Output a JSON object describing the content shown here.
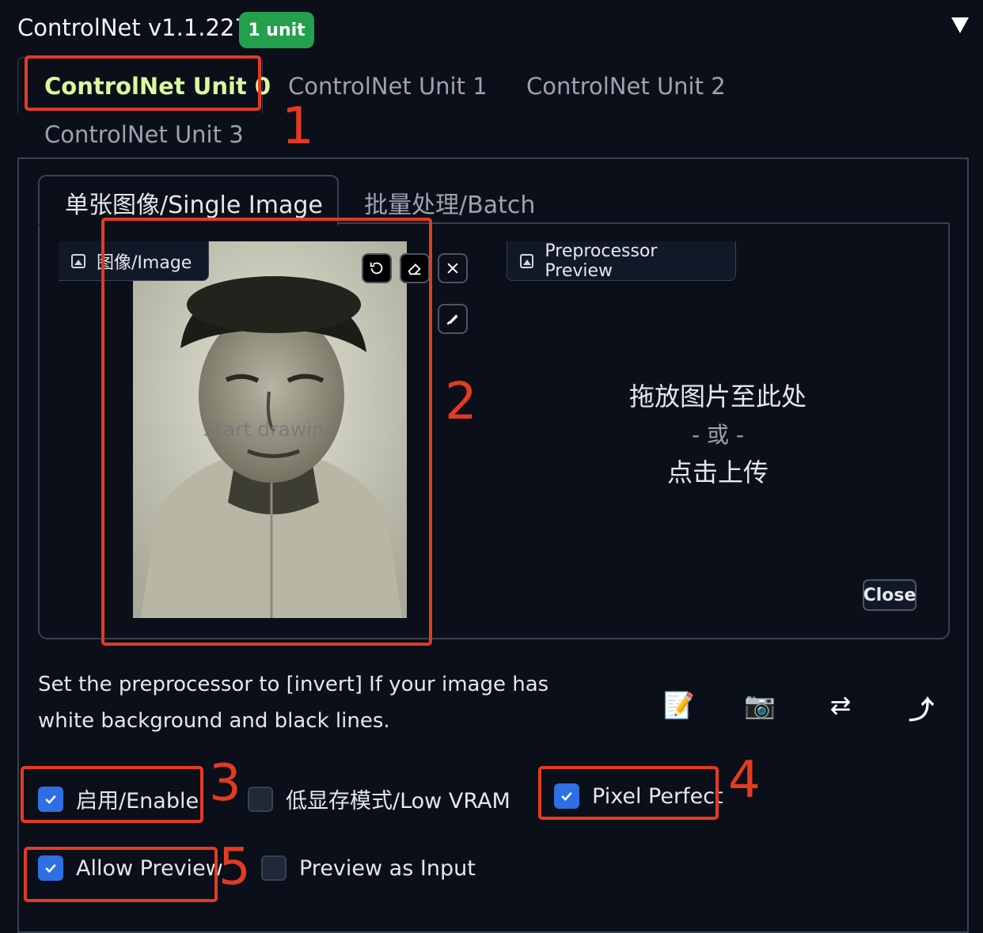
{
  "header": {
    "title": "ControlNet v1.1.227",
    "badge": "1 unit"
  },
  "unit_tabs": [
    "ControlNet Unit 0",
    "ControlNet Unit 1",
    "ControlNet Unit 2",
    "ControlNet Unit 3"
  ],
  "sub_tabs": {
    "single": "单张图像/Single Image",
    "batch": "批量处理/Batch"
  },
  "image_panel": {
    "label": "图像/Image",
    "placeholder": "Start drawing"
  },
  "preview_panel": {
    "label": "Preprocessor Preview",
    "drop": "拖放图片至此处",
    "or": "- 或 -",
    "click": "点击上传",
    "close": "Close"
  },
  "hint": "Set the preprocessor to [invert] If your image has white background and black lines.",
  "tools": {
    "edit": "📝",
    "camera": "📷",
    "swap": "⇄",
    "send": "⤴"
  },
  "options": {
    "enable": {
      "label": "启用/Enable",
      "checked": true
    },
    "low_vram": {
      "label": "低显存模式/Low VRAM",
      "checked": false
    },
    "pixel_perfect": {
      "label": "Pixel Perfect",
      "checked": true
    },
    "allow_preview": {
      "label": "Allow Preview",
      "checked": true
    },
    "preview_as_input": {
      "label": "Preview as Input",
      "checked": false
    }
  },
  "annotations": [
    "1",
    "2",
    "3",
    "4",
    "5"
  ],
  "colors": {
    "accent_green": "#22a04b",
    "active_tab": "#d9f99d",
    "checkbox": "#2f6fe4",
    "annotation": "#e33b22",
    "background": "#0b0f19"
  }
}
